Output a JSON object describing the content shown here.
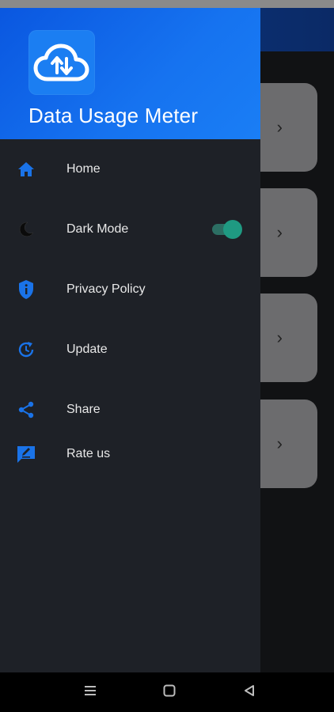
{
  "app": {
    "title": "Data Usage Meter"
  },
  "drawer": {
    "items": [
      {
        "label": "Home",
        "icon": "home-icon"
      },
      {
        "label": "Dark Mode",
        "icon": "moon-icon",
        "toggle": true,
        "enabled": true
      },
      {
        "label": "Privacy Policy",
        "icon": "shield-info-icon"
      },
      {
        "label": "Update",
        "icon": "refresh-icon"
      },
      {
        "label": "Share",
        "icon": "share-icon"
      },
      {
        "label": "Rate us",
        "icon": "feedback-icon"
      }
    ]
  },
  "background_cards": [
    {
      "chevron": "›"
    },
    {
      "chevron": "›"
    },
    {
      "chevron": "›"
    },
    {
      "chevron": "›"
    }
  ],
  "navbar": {
    "items": [
      "menu-icon",
      "home-square-icon",
      "back-triangle-icon"
    ]
  },
  "colors": {
    "accent": "#1a73e8",
    "drawer_bg": "#1e2127",
    "toggle_on": "#1f9a82"
  }
}
